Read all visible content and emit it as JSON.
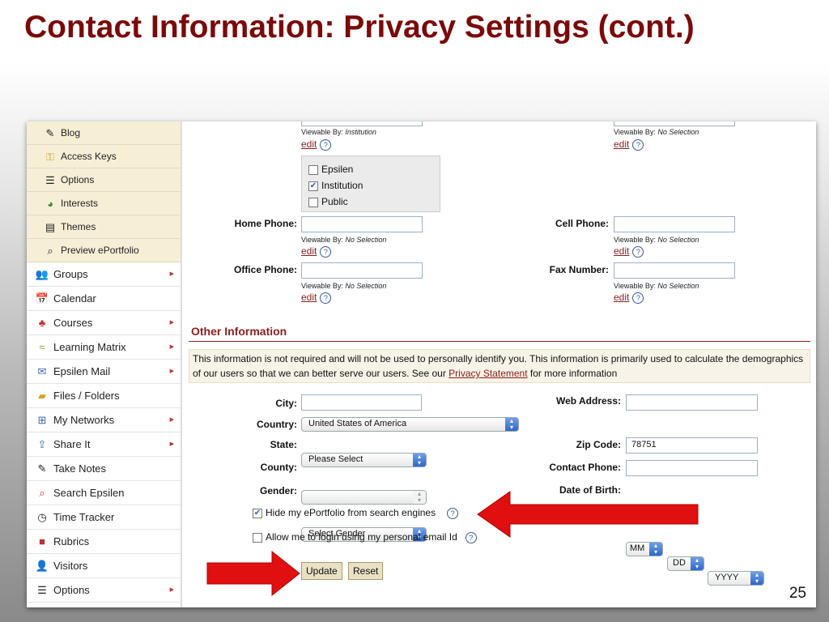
{
  "slide": {
    "title": "Contact Information: Privacy Settings (cont.)",
    "number": "25"
  },
  "sidebar": {
    "sub_items": [
      {
        "label": "Blog",
        "icon": "blog-icon"
      },
      {
        "label": "Access Keys",
        "icon": "key-icon"
      },
      {
        "label": "Options",
        "icon": "options-icon"
      },
      {
        "label": "Interests",
        "icon": "interests-icon"
      },
      {
        "label": "Themes",
        "icon": "themes-icon"
      },
      {
        "label": "Preview ePortfolio",
        "icon": "preview-icon"
      }
    ],
    "main_items": [
      {
        "label": "Groups"
      },
      {
        "label": "Calendar"
      },
      {
        "label": "Courses"
      },
      {
        "label": "Learning Matrix"
      },
      {
        "label": "Epsilen Mail"
      },
      {
        "label": "Files / Folders"
      },
      {
        "label": "My Networks"
      },
      {
        "label": "Share It"
      },
      {
        "label": "Take Notes"
      },
      {
        "label": "Search Epsilen"
      },
      {
        "label": "Time Tracker"
      },
      {
        "label": "Rubrics"
      },
      {
        "label": "Visitors"
      },
      {
        "label": "Options"
      }
    ]
  },
  "visibility": {
    "viewable_by_prefix": "Viewable By:",
    "edit_label": "edit",
    "help_glyph": "?",
    "top_left_value": "Institution",
    "top_right_value": "No Selection",
    "options": [
      {
        "label": "Epsilen",
        "checked": false
      },
      {
        "label": "Institution",
        "checked": true
      },
      {
        "label": "Public",
        "checked": false
      }
    ]
  },
  "contact_fields": {
    "home_phone": {
      "label": "Home Phone:",
      "viewable": "No Selection"
    },
    "cell_phone": {
      "label": "Cell Phone:",
      "viewable": "No Selection"
    },
    "office_phone": {
      "label": "Office Phone:",
      "viewable": "No Selection"
    },
    "fax_number": {
      "label": "Fax Number:",
      "viewable": "No Selection"
    }
  },
  "other_info": {
    "title": "Other Information",
    "notice_part1": "This information is not required and will not be used to personally identify you. This information is primarily used to calculate the demographics of our users so that we can better serve our users. See our ",
    "notice_link": "Privacy Statement",
    "notice_part2": " for more information",
    "city": {
      "label": "City:",
      "value": ""
    },
    "country": {
      "label": "Country:",
      "value": "United States of America"
    },
    "state": {
      "label": "State:",
      "value": "Please Select"
    },
    "county": {
      "label": "County:",
      "value": ""
    },
    "gender": {
      "label": "Gender:",
      "value": "Select Gender"
    },
    "web_address": {
      "label": "Web Address:",
      "value": ""
    },
    "zip_code": {
      "label": "Zip Code:",
      "value": "78751"
    },
    "contact_phone": {
      "label": "Contact Phone:",
      "value": ""
    },
    "date_of_birth": {
      "label": "Date of Birth:",
      "month": "MM",
      "day": "DD",
      "year": "YYYY"
    },
    "hide_eportfolio": {
      "label": "Hide my ePortfolio from search engines",
      "checked": true
    },
    "allow_email_login": {
      "label": "Allow me to login using my personal email Id",
      "checked": false
    }
  },
  "buttons": {
    "update": "Update",
    "reset": "Reset"
  },
  "colors": {
    "title": "#7a0a0a",
    "accent": "#8a1e1e",
    "arrow": "#e01010"
  }
}
